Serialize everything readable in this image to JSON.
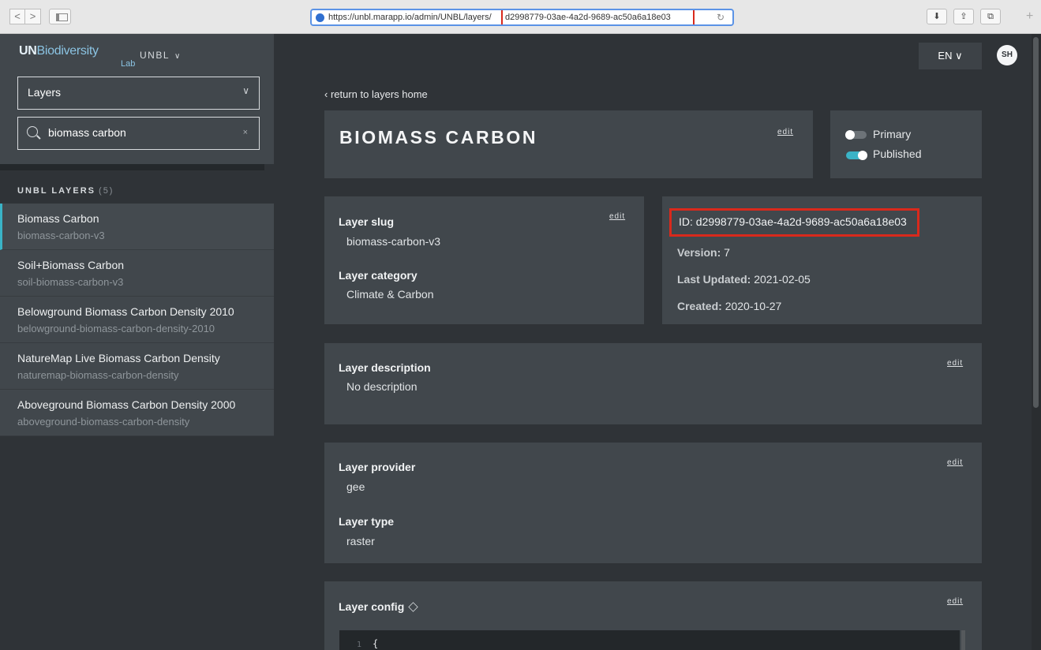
{
  "browser": {
    "nav_back": "<",
    "nav_forward": ">",
    "url_prefix": "https://unbl.marapp.io/admin/UNBL/layers/",
    "url_id": "d2998779-03ae-4a2d-9689-ac50a6a18e03",
    "reload": "↻",
    "download": "⬇",
    "share": "⇪",
    "tabs": "⧉",
    "new_tab": "+"
  },
  "brand": {
    "logo_un": "UN",
    "logo_bio": "Biodiversity",
    "logo_lab": "Lab",
    "org": "UNBL",
    "org_chevron": "∨"
  },
  "sidebar": {
    "type_select": "Layers",
    "type_chevron": "∨",
    "search_value": "biomass carbon",
    "search_clear": "×",
    "heading": "UNBL LAYERS",
    "count": "(5)",
    "items": [
      {
        "title": "Biomass Carbon",
        "slug": "biomass-carbon-v3"
      },
      {
        "title": "Soil+Biomass Carbon",
        "slug": "soil-biomass-carbon-v3"
      },
      {
        "title": "Belowground Biomass Carbon Density 2010",
        "slug": "belowground-biomass-carbon-density-2010"
      },
      {
        "title": "NatureMap Live Biomass Carbon Density",
        "slug": "naturemap-biomass-carbon-density"
      },
      {
        "title": "Aboveground Biomass Carbon Density 2000",
        "slug": "aboveground-biomass-carbon-density"
      }
    ]
  },
  "header": {
    "language": "EN ∨",
    "avatar": "SH"
  },
  "main": {
    "back": "‹ return to layers home",
    "title": "BIOMASS CARBON",
    "edit": "edit",
    "primary": "Primary",
    "published": "Published",
    "slug_label": "Layer slug",
    "slug_value": "biomass-carbon-v3",
    "category_label": "Layer category",
    "category_value": "Climate & Carbon",
    "id_text": "ID: d2998779-03ae-4a2d-9689-ac50a6a18e03",
    "version_key": "Version:",
    "version_val": "7",
    "updated_key": "Last Updated:",
    "updated_val": "2021-02-05",
    "created_key": "Created:",
    "created_val": "2020-10-27",
    "desc_label": "Layer description",
    "desc_value": "No description",
    "provider_label": "Layer provider",
    "provider_value": "gee",
    "type_label": "Layer type",
    "type_value": "raster",
    "config_label": "Layer config",
    "code_line_no": "1",
    "code_line": "{"
  },
  "colors": {
    "accent": "#3ab3c6",
    "highlight": "#d9291c",
    "panel": "#41474c",
    "background": "#2f3337"
  }
}
